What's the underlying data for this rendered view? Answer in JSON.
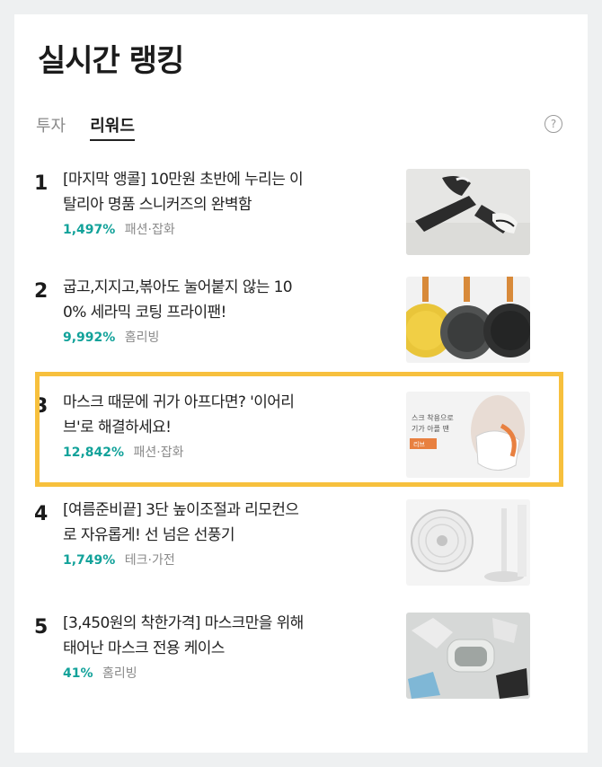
{
  "title": "실시간 랭킹",
  "tabs": [
    {
      "label": "투자",
      "active": false
    },
    {
      "label": "리워드",
      "active": true
    }
  ],
  "help_glyph": "?",
  "items": [
    {
      "rank": "1",
      "line1": "[마지막 앵콜] 10만원 초반에 누리는 이",
      "line2": "탈리아 명품 스니커즈의 완벽함",
      "percent": "1,497%",
      "category": "패션·잡화",
      "image": "sneakers-photo"
    },
    {
      "rank": "2",
      "line1": "굽고,지지고,볶아도 눌어붙지 않는 10",
      "line2": "0% 세라믹 코팅 프라이팬!",
      "percent": "9,992%",
      "category": "홈리빙",
      "image": "frying-pans-photo"
    },
    {
      "rank": "3",
      "line1": "마스크 때문에 귀가 아프다면? '이어리",
      "line2": "브'로 해결하세요!",
      "percent": "12,842%",
      "category": "패션·잡화",
      "image": "mask-ear-saver-photo",
      "thumb_caption_1": "스크 착용으로",
      "thumb_caption_2": "기가 아플 땐",
      "thumb_badge": "리브"
    },
    {
      "rank": "4",
      "line1": "[여름준비끝] 3단 높이조절과 리모컨으",
      "line2": "로 자유롭게! 선 넘은 선풍기",
      "percent": "1,749%",
      "category": "테크·가전",
      "image": "fan-photo"
    },
    {
      "rank": "5",
      "line1": "[3,450원의 착한가격] 마스크만을 위해",
      "line2": "태어난 마스크 전용 케이스",
      "percent": "41%",
      "category": "홈리빙",
      "image": "mask-case-photo"
    }
  ],
  "colors": {
    "accent": "#12a29a",
    "highlight": "#f7c03d",
    "background": "#eef0f1"
  }
}
